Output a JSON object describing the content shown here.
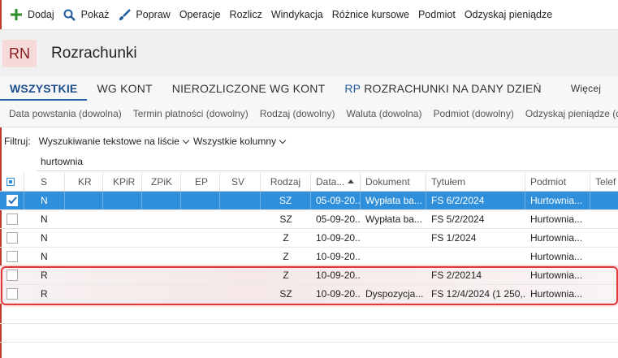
{
  "toolbar": {
    "items": [
      {
        "label": "Dodaj",
        "icon": "plus-icon"
      },
      {
        "label": "Pokaż",
        "icon": "search-icon"
      },
      {
        "label": "Popraw",
        "icon": "brush-icon"
      },
      {
        "label": "Operacje"
      },
      {
        "label": "Rozlicz"
      },
      {
        "label": "Windykacja"
      },
      {
        "label": "Różnice kursowe"
      },
      {
        "label": "Podmiot"
      },
      {
        "label": "Odzyskaj pieniądze"
      }
    ]
  },
  "header": {
    "badge": "RN",
    "title": "Rozrachunki"
  },
  "tabs": [
    {
      "label": "WSZYSTKIE",
      "active": true
    },
    {
      "label": "WG KONT"
    },
    {
      "label": "NIEROZLICZONE WG KONT"
    },
    {
      "prefix": "RP",
      "label": "ROZRACHUNKI NA DANY DZIEŃ"
    },
    {
      "label": "Więcej"
    }
  ],
  "filters": [
    "Data powstania (dowolna)",
    "Termin płatności (dowolny)",
    "Rodzaj (dowolny)",
    "Waluta (dowolna)",
    "Podmiot (dowolny)",
    "Odzyskaj pieniądze (do"
  ],
  "search": {
    "label": "Filtruj:",
    "mode": "Wyszukiwanie tekstowe na liście",
    "columns": "Wszystkie kolumny",
    "value": "hurtownia"
  },
  "grid": {
    "columns": [
      "S",
      "KR",
      "KPiR",
      "ZPiK",
      "EP",
      "SV",
      "Rodzaj",
      "Data...",
      "Dokument",
      "Tytułem",
      "Podmiot",
      "Telef"
    ],
    "rows": [
      {
        "s": "N",
        "rodzaj": "SZ",
        "data": "05-09-20...",
        "dokument": "Wypłata ba...",
        "tytulem": "FS 6/2/2024",
        "podmiot": "Hurtownia...",
        "selected": true
      },
      {
        "s": "N",
        "rodzaj": "SZ",
        "data": "05-09-20...",
        "dokument": "Wypłata ba...",
        "tytulem": "FS 5/2/2024",
        "podmiot": "Hurtownia..."
      },
      {
        "s": "N",
        "rodzaj": "Z",
        "data": "10-09-20...",
        "dokument": "",
        "tytulem": "FS 1/2024",
        "podmiot": "Hurtownia..."
      },
      {
        "s": "N",
        "rodzaj": "Z",
        "data": "10-09-20...",
        "dokument": "",
        "tytulem": "",
        "podmiot": "Hurtownia..."
      },
      {
        "s": "R",
        "rodzaj": "Z",
        "data": "10-09-20...",
        "dokument": "",
        "tytulem": "FS 2/20214",
        "podmiot": "Hurtownia...",
        "highlighted": true
      },
      {
        "s": "R",
        "rodzaj": "SZ",
        "data": "10-09-20...",
        "dokument": "Dyspozycja...",
        "tytulem": "FS 12/4/2024 (1 250,...",
        "podmiot": "Hurtownia...",
        "highlighted": true
      }
    ]
  },
  "colors": {
    "accent": "#2f8fdb",
    "brand": "#8b1c1c",
    "highlight_border": "#e03a3a"
  }
}
